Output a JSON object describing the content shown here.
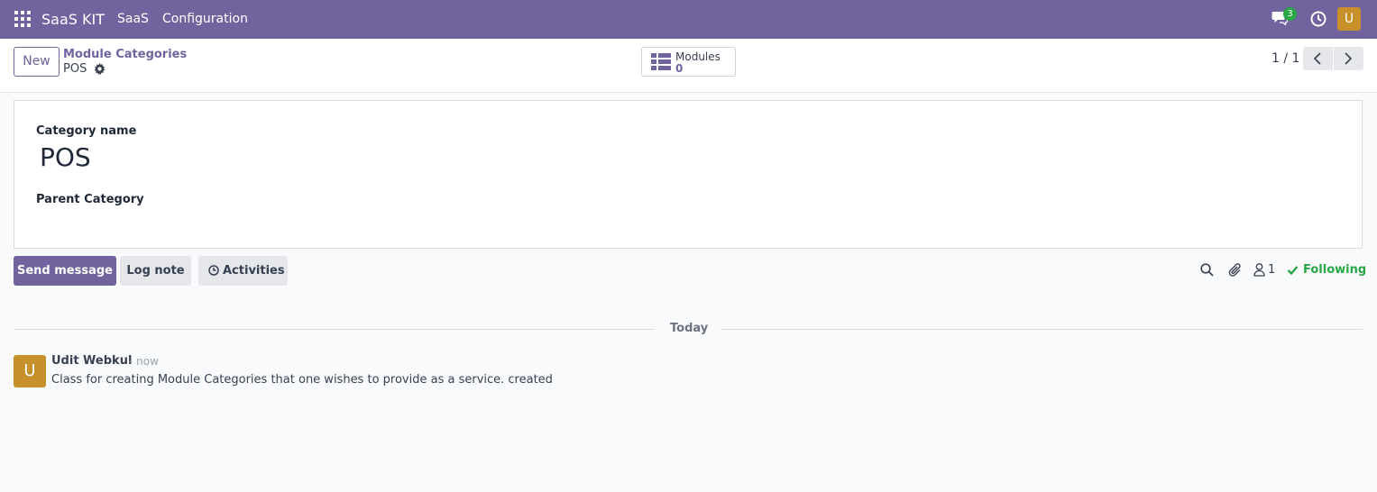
{
  "navbar": {
    "brand": "SaaS KIT",
    "menu": [
      "SaaS",
      "Configuration"
    ],
    "chat_badge": "3",
    "user_initial": "U",
    "color": "#71639e"
  },
  "control_panel": {
    "new_label": "New",
    "breadcrumb_parent": "Module Categories",
    "breadcrumb_current": "POS",
    "smart_button": {
      "label": "Modules",
      "value": "0"
    },
    "pager": "1 / 1"
  },
  "form": {
    "category_name_label": "Category name",
    "category_name_value": "POS",
    "parent_category_label": "Parent Category"
  },
  "chatter": {
    "send_message": "Send message",
    "log_note": "Log note",
    "activities": "Activities",
    "follower_count": "1",
    "following": "Following",
    "separator": "Today",
    "message": {
      "avatar_initial": "U",
      "author": "Udit Webkul",
      "date": "- now",
      "body": "Class for creating Module Categories that one wishes to provide as a service. created"
    }
  }
}
